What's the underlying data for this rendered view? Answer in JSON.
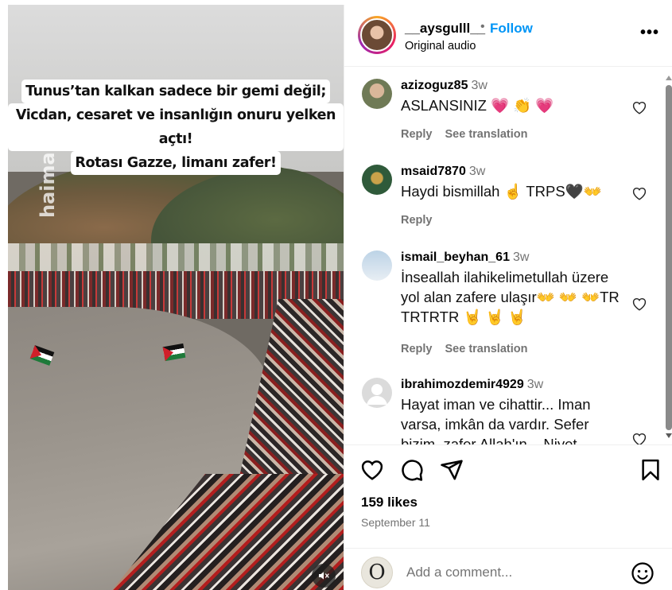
{
  "video": {
    "caption_lines": [
      "Tunus’tan kalkan sadece bir gemi değil;",
      "Vicdan, cesaret ve insanlığın onuru yelken açtı!",
      "Rotası Gazze, limanı zafer!"
    ],
    "watermark": "haimare",
    "mute_icon": "speaker-muted-icon"
  },
  "post": {
    "username": "__aysgulll__",
    "separator": "•",
    "follow_label": "Follow",
    "audio_label": "Original audio",
    "more_icon": "•••"
  },
  "comments": [
    {
      "username": "azizoguz85",
      "time": "3w",
      "text": "ASLANSINIZ 💗 👏 💗",
      "actions": [
        "Reply",
        "See translation"
      ]
    },
    {
      "username": "msaid7870",
      "time": "3w",
      "text": "Haydi bismillah ☝️ TRPS🖤👐",
      "actions": [
        "Reply"
      ]
    },
    {
      "username": "ismail_beyhan_61",
      "time": "3w",
      "text": "İnseallah ilahikelimetullah üzere yol alan zafere ulaşır👐 👐 👐TR TRTRTR 🤘 🤘 🤘",
      "actions": [
        "Reply",
        "See translation"
      ]
    },
    {
      "username": "ibrahimozdemir4929",
      "time": "3w",
      "text": "Hayat iman ve cihattir... Iman varsa, imkân da vardır. Sefer bizim, zafer Allah'ın... Niyet",
      "actions": []
    }
  ],
  "engagement": {
    "likes": "159 likes",
    "date": "September 11"
  },
  "composer": {
    "avatar_letter": "O",
    "placeholder": "Add a comment..."
  },
  "colors": {
    "accent": "#0095f6",
    "muted": "#737373",
    "heart": "#e0245e"
  }
}
